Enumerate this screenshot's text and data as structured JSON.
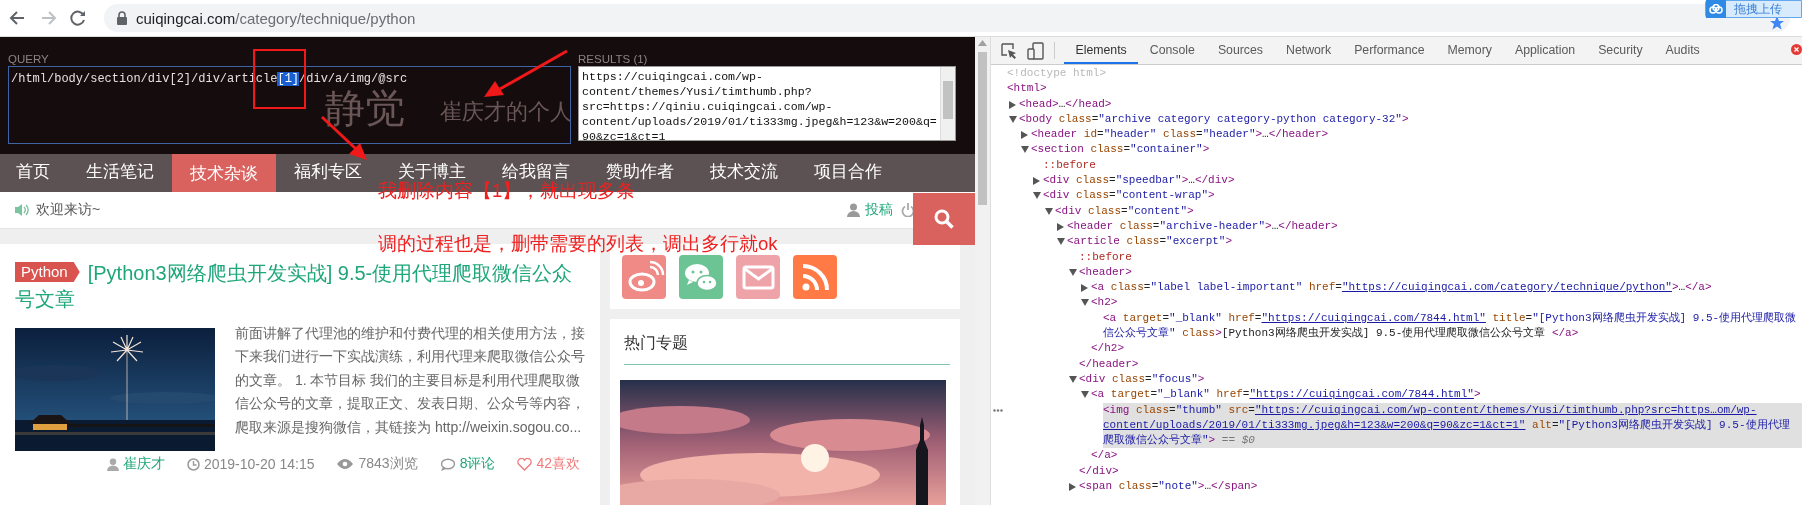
{
  "browser": {
    "url_host": "cuiqingcai.com",
    "url_path": "/category/technique/python",
    "upload_badge": "拖拽上传"
  },
  "xpath_helper": {
    "query_label": "QUERY",
    "query_parts": [
      {
        "text": "/html/body/section/div[2]/div/article",
        "selected": false
      },
      {
        "text": "[1]",
        "selected": true
      },
      {
        "text": "/div/a/img/@src",
        "selected": false
      }
    ],
    "results_label": "RESULTS (1)",
    "results": "https://cuiqingcai.com/wp-content/themes/Yusi/timthumb.php?src=https://qiniu.cuiqingcai.com/wp-content/uploads/2019/01/ti333mg.jpeg&h=123&w=200&q=90&zc=1&ct=1"
  },
  "site": {
    "logo": "静觉",
    "tagline": "崔庆才的个人"
  },
  "nav": [
    {
      "label": "首页",
      "selected": false
    },
    {
      "label": "生活笔记",
      "selected": false
    },
    {
      "label": "技术杂谈",
      "selected": true
    },
    {
      "label": "福利专区",
      "selected": false
    },
    {
      "label": "关于博主",
      "selected": false
    },
    {
      "label": "给我留言",
      "selected": false
    },
    {
      "label": "赞助作者",
      "selected": false
    },
    {
      "label": "技术交流",
      "selected": false
    },
    {
      "label": "项目合作",
      "selected": false
    }
  ],
  "annotations": [
    {
      "text": "我删除内容【1】，就出现多条"
    },
    {
      "text": "调的过程也是，删带需要的列表，调出多行就ok"
    }
  ],
  "welcome": {
    "text": "欢迎来访~",
    "contribute": "投稿"
  },
  "article": {
    "tag": "Python",
    "title": "[Python3网络爬虫开发实战] 9.5-使用代理爬取微信公众号文章",
    "excerpt": "前面讲解了代理池的维护和付费代理的相关使用方法，接下来我们进行一下实战演练，利用代理来爬取微信公众号的文章。 1. 本节目标 我们的主要目标是利用代理爬取微信公众号的文章，提取正文、发表日期、公众号等内容，爬取来源是搜狗微信，其链接为 http://weixin.sogou.co...",
    "author": "崔庆才",
    "date": "2019-10-20 14:15",
    "views": "7843浏览",
    "comments": "8评论",
    "likes": "42喜欢"
  },
  "sidebar": {
    "social": [
      {
        "kind": "weibo"
      },
      {
        "kind": "wechat"
      },
      {
        "kind": "mail"
      },
      {
        "kind": "rss"
      }
    ],
    "hot_title": "热门专题"
  },
  "devtools": {
    "tabs": [
      {
        "label": "Elements",
        "selected": true
      },
      {
        "label": "Console",
        "selected": false
      },
      {
        "label": "Sources",
        "selected": false
      },
      {
        "label": "Network",
        "selected": false
      },
      {
        "label": "Performance",
        "selected": false
      },
      {
        "label": "Memory",
        "selected": false
      },
      {
        "label": "Application",
        "selected": false
      },
      {
        "label": "Security",
        "selected": false
      },
      {
        "label": "Audits",
        "selected": false
      }
    ],
    "tree": [
      {
        "line": "<!doctype html>",
        "kind": "doctype",
        "selected": false
      },
      {
        "line": "<html>",
        "kind": "element",
        "selected": false,
        "children": [
          {
            "line": "<head>…</head>",
            "kind": "element",
            "expanded": false,
            "selected": false
          },
          {
            "line": "<body class=\"archive category category-python category-32\">",
            "kind": "element",
            "expanded": true,
            "selected": false,
            "children": [
              {
                "line": "<header id=\"header\" class=\"header\">…</header>",
                "kind": "element",
                "expanded": false,
                "selected": false
              },
              {
                "line": "<section class=\"container\">",
                "kind": "element",
                "expanded": true,
                "selected": false,
                "children": [
                  {
                    "line": "::before",
                    "kind": "pseudo",
                    "selected": false
                  },
                  {
                    "line": "<div class=\"speedbar\">…</div>",
                    "kind": "element",
                    "expanded": false,
                    "selected": false
                  },
                  {
                    "line": "<div class=\"content-wrap\">",
                    "kind": "element",
                    "expanded": true,
                    "selected": false,
                    "children": [
                      {
                        "line": "<div class=\"content\">",
                        "kind": "element",
                        "expanded": true,
                        "selected": false,
                        "children": [
                          {
                            "line": "<header class=\"archive-header\">…</header>",
                            "kind": "element",
                            "expanded": false,
                            "selected": false
                          },
                          {
                            "line": "<article class=\"excerpt\">",
                            "kind": "element",
                            "expanded": true,
                            "selected": false,
                            "children": [
                              {
                                "line": "::before",
                                "kind": "pseudo",
                                "selected": false
                              },
                              {
                                "line": "<header>",
                                "kind": "element",
                                "expanded": true,
                                "selected": false,
                                "close": "</header>",
                                "children": [
                                  {
                                    "line": "<a class=\"label label-important\" href=\"https://cuiqingcai.com/category/technique/python\">…</a>",
                                    "kind": "element",
                                    "expanded": false,
                                    "selected": false
                                  },
                                  {
                                    "line": "<h2>",
                                    "kind": "element",
                                    "expanded": true,
                                    "selected": false,
                                    "close": "</h2>",
                                    "children": [
                                      {
                                        "line": "<a target=\"_blank\" href=\"https://cuiqingcai.com/7844.html\" title=\"[Python3网络爬虫开发实战] 9.5-使用代理爬取微信公众号文章\" class>[Python3网络爬虫开发实战] 9.5-使用代理爬取微信公众号文章  </a>",
                                        "kind": "element",
                                        "selected": false
                                      }
                                    ]
                                  }
                                ]
                              },
                              {
                                "line": "<div class=\"focus\">",
                                "kind": "element",
                                "expanded": true,
                                "selected": false,
                                "close": "</div>",
                                "children": [
                                  {
                                    "line": "<a target=\"_blank\" href=\"https://cuiqingcai.com/7844.html\">",
                                    "kind": "element",
                                    "expanded": true,
                                    "selected": false,
                                    "close": "</a>",
                                    "children": [
                                      {
                                        "line": "<img class=\"thumb\" src=\"https://cuiqingcai.com/wp-content/themes/Yusi/timthumb.php?src=https…om/wp-content/uploads/2019/01/ti333mg.jpeg&h=123&w=200&q=90&zc=1&ct=1\" alt=\"[Python3网络爬虫开发实战] 9.5-使用代理爬取微信公众号文章\">",
                                        "console_ref": "== $0",
                                        "kind": "element",
                                        "selected": true
                                      }
                                    ]
                                  }
                                ]
                              },
                              {
                                "line": "<span class=\"note\">…</span>",
                                "kind": "element",
                                "expanded": false,
                                "selected": false
                              }
                            ]
                          }
                        ]
                      }
                    ]
                  }
                ]
              }
            ]
          }
        ]
      }
    ]
  }
}
